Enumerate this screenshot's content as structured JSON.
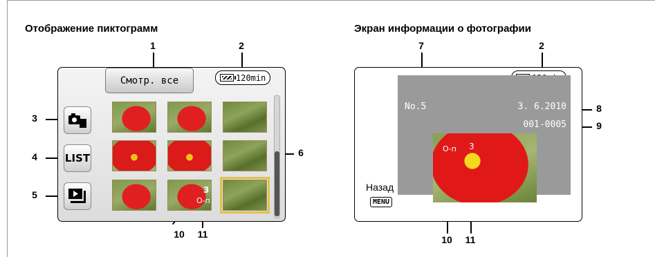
{
  "left": {
    "title": "Отображение пиктограмм",
    "play_all_label": "Смотр. все",
    "battery_text": "120min",
    "list_label": "LIST",
    "folder_count": "3",
    "key_symbol": "О-п",
    "callouts": [
      "1",
      "2",
      "3",
      "4",
      "5",
      "6",
      "10",
      "11"
    ]
  },
  "right": {
    "title": "Экран информации о фотографии",
    "battery_text": "120min",
    "file_no": "No.5",
    "date": "3. 6.2010",
    "file_number": "001-0005",
    "count": "3",
    "key_symbol": "О-п",
    "back_label": "Назад",
    "menu_label": "MENU",
    "callouts": [
      "7",
      "2",
      "8",
      "9",
      "10",
      "11"
    ]
  },
  "thumbnails": [
    {
      "type": "tulip"
    },
    {
      "type": "tulip"
    },
    {
      "type": "grass"
    },
    {
      "type": "tulip-close"
    },
    {
      "type": "tulip-close"
    },
    {
      "type": "grass"
    },
    {
      "type": "tulip"
    },
    {
      "type": "tulip"
    },
    {
      "type": "grass",
      "selected": true
    }
  ]
}
